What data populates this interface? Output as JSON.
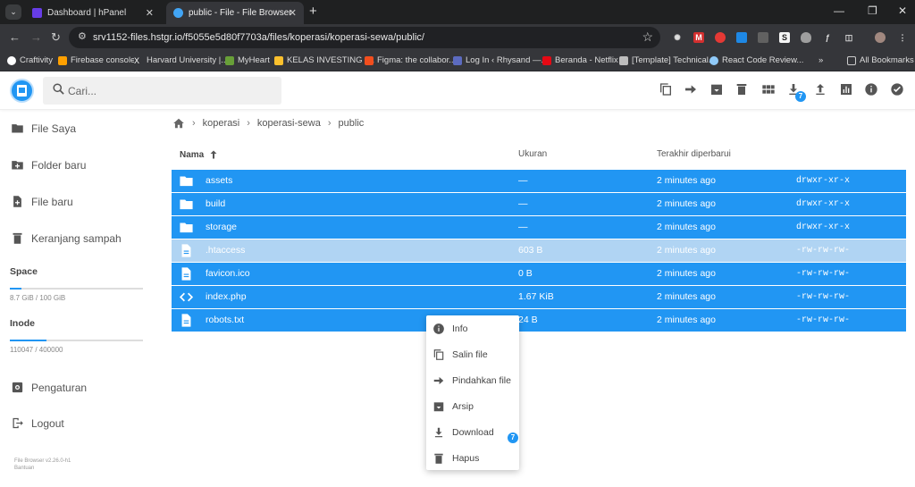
{
  "browser": {
    "tabs": [
      {
        "title": "Dashboard | hPanel",
        "active": false,
        "icon": "hpanel-icon"
      },
      {
        "title": "public - File - File Browser",
        "active": true,
        "icon": "filebrowser-icon"
      }
    ],
    "url": "srv1152-files.hstgr.io/f5055e5d80f7703a/files/koperasi/koperasi-sewa/public/",
    "bookmarks": [
      "Craftivity",
      "Firebase console",
      "Harvard University |...",
      "MyHeart",
      "KELAS INVESTING -...",
      "Figma: the collabor...",
      "Log In ‹ Rhysand —...",
      "Beranda - Netflix",
      "[Template] Technical...",
      "React Code Review..."
    ],
    "all_bookmarks": "All Bookmarks"
  },
  "search": {
    "placeholder": "Cari..."
  },
  "header": {
    "download_badge": "7"
  },
  "sidebar": {
    "items": [
      "File Saya",
      "Folder baru",
      "File baru",
      "Keranjang sampah"
    ],
    "space_label": "Space",
    "space_value": "8.7 GiB / 100 GiB",
    "space_fraction": 0.087,
    "inode_label": "Inode",
    "inode_value": "110047 / 400000",
    "inode_fraction": 0.275,
    "settings": "Pengaturan",
    "logout": "Logout",
    "version": "File Browser v2.26.0-h1",
    "help": "Bantuan"
  },
  "breadcrumb": [
    "koperasi",
    "koperasi-sewa",
    "public"
  ],
  "columns": {
    "name": "Nama",
    "size": "Ukuran",
    "modified": "Terakhir diperbarui"
  },
  "files": [
    {
      "name": "assets",
      "size": "—",
      "modified": "2 minutes ago",
      "perm": "drwxr-xr-x",
      "type": "folder",
      "dim": false
    },
    {
      "name": "build",
      "size": "—",
      "modified": "2 minutes ago",
      "perm": "drwxr-xr-x",
      "type": "folder",
      "dim": false
    },
    {
      "name": "storage",
      "size": "—",
      "modified": "2 minutes ago",
      "perm": "drwxr-xr-x",
      "type": "folder",
      "dim": false
    },
    {
      "name": ".htaccess",
      "size": "603 B",
      "modified": "2 minutes ago",
      "perm": "-rw-rw-rw-",
      "type": "file",
      "dim": true
    },
    {
      "name": "favicon.ico",
      "size": "0 B",
      "modified": "2 minutes ago",
      "perm": "-rw-rw-rw-",
      "type": "file",
      "dim": false
    },
    {
      "name": "index.php",
      "size": "1.67 KiB",
      "modified": "2 minutes ago",
      "perm": "-rw-rw-rw-",
      "type": "code",
      "dim": false
    },
    {
      "name": "robots.txt",
      "size": "24 B",
      "modified": "2 minutes ago",
      "perm": "-rw-rw-rw-",
      "type": "file",
      "dim": false
    }
  ],
  "context_menu": {
    "items": [
      "Info",
      "Salin file",
      "Pindahkan file",
      "Arsip",
      "Download",
      "Hapus"
    ],
    "download_badge": "7"
  },
  "colors": {
    "accent": "#2196f3",
    "selected_dim": "#b0d4f3"
  }
}
